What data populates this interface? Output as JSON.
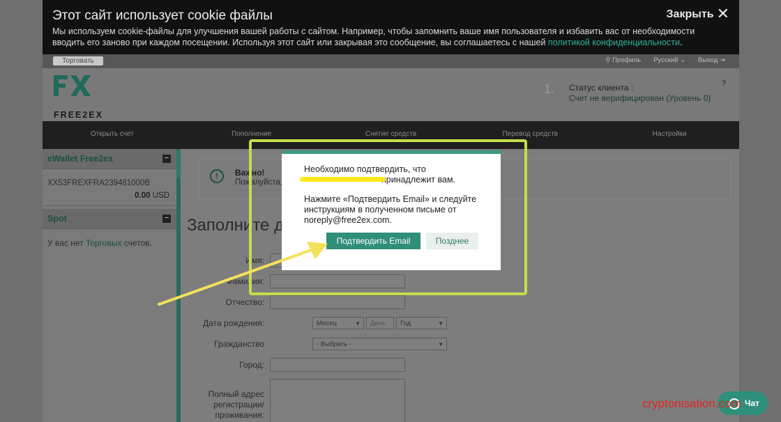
{
  "cookie": {
    "title": "Этот сайт использует cookie файлы",
    "text": "Мы используем cookie-файлы для улучшения вашей работы с сайтом. Например, чтобы запомнить ваше имя пользователя и избавить вас от необходимости вводить его заново при каждом посещении. Используя этот сайт или закрывая это сообщение, вы соглашаетесь с нашей ",
    "link": "политикой конфиденциальности",
    "link_suffix": ".",
    "close_label": "Закрыть"
  },
  "topbar": {
    "trade": "Торговать",
    "profile": "Профиль",
    "language": "Русский",
    "logout": "Выход"
  },
  "header": {
    "logo_text": "FREE2EX",
    "status_number": "1.",
    "status_label": "Статус клиента :",
    "status_value": "Счет не верифицирован (Уровень 0)",
    "help": "?"
  },
  "nav": [
    "Открыть счет",
    "Пополнение",
    "Снятие средств",
    "Перевод средств",
    "Настройки"
  ],
  "sidebar": {
    "ewallet_title": "eWallet Free2ex",
    "account_number": "XX53FREXFRA239481000B",
    "balance": "0.00",
    "currency": "USD",
    "spot_title": "Spot",
    "spot_prefix": "У вас нет ",
    "spot_link": "Торговых",
    "spot_suffix": " счетов."
  },
  "alert": {
    "title": "Важно!",
    "text": "Пожалуйста,"
  },
  "form": {
    "title": "Заполните д",
    "labels": {
      "first_name": "Имя:",
      "last_name": "Фамилия:",
      "patronymic": "Отчество:",
      "dob": "Дата рождения:",
      "citizenship": "Гражданство",
      "city": "Город:",
      "address_1": "Полный адрес",
      "address_2": "регистрации/",
      "address_3": "проживания:"
    },
    "dob_month": "Месяц",
    "dob_day": "День",
    "dob_year": "Год",
    "citizenship_placeholder": "- Выбрать -"
  },
  "modal": {
    "line1": "Необходимо подтвердить, что",
    "line2_suffix": "принадлежит вам.",
    "instructions": "Нажмите «Подтвердить Email» и следуйте инструкциям в полученном письме от noreply@free2ex.com.",
    "confirm_label": "Подтвердить Email",
    "later_label": "Позднее"
  },
  "chat_label": "Чат",
  "watermark": "cryptonisation.com",
  "colors": {
    "accent": "#2f8f79",
    "annotation": "#c7dc4c",
    "arrow": "#f5e05a"
  }
}
